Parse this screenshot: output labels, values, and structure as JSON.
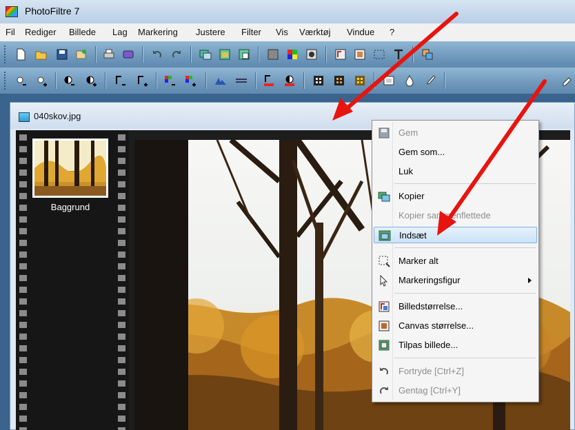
{
  "window": {
    "title": "PhotoFiltre 7"
  },
  "menubar": {
    "items": [
      "Fil",
      "Rediger",
      "Billede",
      "Lag",
      "Markering",
      "Justere",
      "Filter",
      "Vis",
      "Værktøj",
      "Vindue",
      "?"
    ]
  },
  "toolbar1": {
    "icons": [
      "new-icon",
      "open-icon",
      "save-icon",
      "scan-icon",
      "print-icon",
      "export-icon",
      "undo-icon",
      "redo-icon",
      "copy-image-icon",
      "paste-image-icon",
      "paste-layer-icon",
      "gradient-icon",
      "color-grid-icon",
      "mask-icon",
      "image-size-icon",
      "canvas-size-icon",
      "selection-icon",
      "text-icon",
      "layers-icon"
    ]
  },
  "toolbar2": {
    "icons": [
      "brightness-minus-icon",
      "brightness-plus-icon",
      "contrast-minus-icon",
      "contrast-plus-icon",
      "gamma-minus-icon",
      "gamma-plus-icon",
      "saturation-minus-icon",
      "saturation-plus-icon",
      "auto-level-icon",
      "histogram-icon",
      "gamma-auto-icon",
      "contrast-auto-icon",
      "filter-blur-icon",
      "filter-mosaic-icon",
      "filter-pattern-icon",
      "frame-icon",
      "drop-icon",
      "brush-icon",
      "script-icon"
    ]
  },
  "document": {
    "title": "040skov.jpg"
  },
  "layers": {
    "items": [
      {
        "label": "Baggrund"
      }
    ]
  },
  "context_menu": {
    "items": [
      {
        "label": "Gem",
        "icon": "save-icon",
        "disabled": true
      },
      {
        "label": "Gem som...",
        "icon": "",
        "disabled": false
      },
      {
        "label": "Luk",
        "icon": "",
        "disabled": false
      },
      {
        "label": "Kopier",
        "icon": "copy-icon",
        "disabled": false
      },
      {
        "label": "Kopier sammenflettede",
        "icon": "",
        "disabled": true
      },
      {
        "label": "Indsæt",
        "icon": "paste-icon",
        "disabled": false,
        "highlighted": true
      },
      {
        "label": "Marker alt",
        "icon": "select-all-icon",
        "disabled": false
      },
      {
        "label": "Markeringsfigur",
        "icon": "pointer-icon",
        "disabled": false,
        "submenu": true
      },
      {
        "label": "Billedstørrelse...",
        "icon": "image-size-icon",
        "disabled": false
      },
      {
        "label": "Canvas størrelse...",
        "icon": "canvas-size-icon",
        "disabled": false
      },
      {
        "label": "Tilpas billede...",
        "icon": "fit-image-icon",
        "disabled": false
      },
      {
        "label": "Fortryde [Ctrl+Z]",
        "icon": "undo-icon",
        "disabled": true
      },
      {
        "label": "Gentag [Ctrl+Y]",
        "icon": "redo-icon",
        "disabled": true
      }
    ]
  },
  "colors": {
    "annotation_arrow": "#e8140e",
    "menu_highlight": "#cde3f8",
    "toolbar": "#7aa3c4"
  }
}
